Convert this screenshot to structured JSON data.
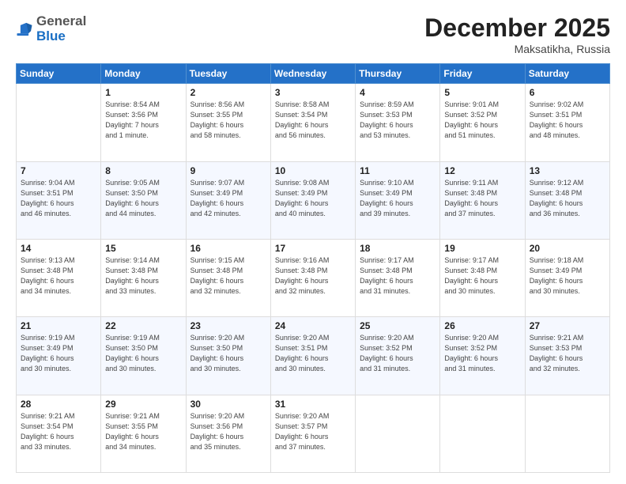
{
  "logo": {
    "general": "General",
    "blue": "Blue"
  },
  "header": {
    "month": "December 2025",
    "location": "Maksatikha, Russia"
  },
  "days_of_week": [
    "Sunday",
    "Monday",
    "Tuesday",
    "Wednesday",
    "Thursday",
    "Friday",
    "Saturday"
  ],
  "weeks": [
    [
      {
        "day": "",
        "info": ""
      },
      {
        "day": "1",
        "info": "Sunrise: 8:54 AM\nSunset: 3:56 PM\nDaylight: 7 hours\nand 1 minute."
      },
      {
        "day": "2",
        "info": "Sunrise: 8:56 AM\nSunset: 3:55 PM\nDaylight: 6 hours\nand 58 minutes."
      },
      {
        "day": "3",
        "info": "Sunrise: 8:58 AM\nSunset: 3:54 PM\nDaylight: 6 hours\nand 56 minutes."
      },
      {
        "day": "4",
        "info": "Sunrise: 8:59 AM\nSunset: 3:53 PM\nDaylight: 6 hours\nand 53 minutes."
      },
      {
        "day": "5",
        "info": "Sunrise: 9:01 AM\nSunset: 3:52 PM\nDaylight: 6 hours\nand 51 minutes."
      },
      {
        "day": "6",
        "info": "Sunrise: 9:02 AM\nSunset: 3:51 PM\nDaylight: 6 hours\nand 48 minutes."
      }
    ],
    [
      {
        "day": "7",
        "info": "Sunrise: 9:04 AM\nSunset: 3:51 PM\nDaylight: 6 hours\nand 46 minutes."
      },
      {
        "day": "8",
        "info": "Sunrise: 9:05 AM\nSunset: 3:50 PM\nDaylight: 6 hours\nand 44 minutes."
      },
      {
        "day": "9",
        "info": "Sunrise: 9:07 AM\nSunset: 3:49 PM\nDaylight: 6 hours\nand 42 minutes."
      },
      {
        "day": "10",
        "info": "Sunrise: 9:08 AM\nSunset: 3:49 PM\nDaylight: 6 hours\nand 40 minutes."
      },
      {
        "day": "11",
        "info": "Sunrise: 9:10 AM\nSunset: 3:49 PM\nDaylight: 6 hours\nand 39 minutes."
      },
      {
        "day": "12",
        "info": "Sunrise: 9:11 AM\nSunset: 3:48 PM\nDaylight: 6 hours\nand 37 minutes."
      },
      {
        "day": "13",
        "info": "Sunrise: 9:12 AM\nSunset: 3:48 PM\nDaylight: 6 hours\nand 36 minutes."
      }
    ],
    [
      {
        "day": "14",
        "info": "Sunrise: 9:13 AM\nSunset: 3:48 PM\nDaylight: 6 hours\nand 34 minutes."
      },
      {
        "day": "15",
        "info": "Sunrise: 9:14 AM\nSunset: 3:48 PM\nDaylight: 6 hours\nand 33 minutes."
      },
      {
        "day": "16",
        "info": "Sunrise: 9:15 AM\nSunset: 3:48 PM\nDaylight: 6 hours\nand 32 minutes."
      },
      {
        "day": "17",
        "info": "Sunrise: 9:16 AM\nSunset: 3:48 PM\nDaylight: 6 hours\nand 32 minutes."
      },
      {
        "day": "18",
        "info": "Sunrise: 9:17 AM\nSunset: 3:48 PM\nDaylight: 6 hours\nand 31 minutes."
      },
      {
        "day": "19",
        "info": "Sunrise: 9:17 AM\nSunset: 3:48 PM\nDaylight: 6 hours\nand 30 minutes."
      },
      {
        "day": "20",
        "info": "Sunrise: 9:18 AM\nSunset: 3:49 PM\nDaylight: 6 hours\nand 30 minutes."
      }
    ],
    [
      {
        "day": "21",
        "info": "Sunrise: 9:19 AM\nSunset: 3:49 PM\nDaylight: 6 hours\nand 30 minutes."
      },
      {
        "day": "22",
        "info": "Sunrise: 9:19 AM\nSunset: 3:50 PM\nDaylight: 6 hours\nand 30 minutes."
      },
      {
        "day": "23",
        "info": "Sunrise: 9:20 AM\nSunset: 3:50 PM\nDaylight: 6 hours\nand 30 minutes."
      },
      {
        "day": "24",
        "info": "Sunrise: 9:20 AM\nSunset: 3:51 PM\nDaylight: 6 hours\nand 30 minutes."
      },
      {
        "day": "25",
        "info": "Sunrise: 9:20 AM\nSunset: 3:52 PM\nDaylight: 6 hours\nand 31 minutes."
      },
      {
        "day": "26",
        "info": "Sunrise: 9:20 AM\nSunset: 3:52 PM\nDaylight: 6 hours\nand 31 minutes."
      },
      {
        "day": "27",
        "info": "Sunrise: 9:21 AM\nSunset: 3:53 PM\nDaylight: 6 hours\nand 32 minutes."
      }
    ],
    [
      {
        "day": "28",
        "info": "Sunrise: 9:21 AM\nSunset: 3:54 PM\nDaylight: 6 hours\nand 33 minutes."
      },
      {
        "day": "29",
        "info": "Sunrise: 9:21 AM\nSunset: 3:55 PM\nDaylight: 6 hours\nand 34 minutes."
      },
      {
        "day": "30",
        "info": "Sunrise: 9:20 AM\nSunset: 3:56 PM\nDaylight: 6 hours\nand 35 minutes."
      },
      {
        "day": "31",
        "info": "Sunrise: 9:20 AM\nSunset: 3:57 PM\nDaylight: 6 hours\nand 37 minutes."
      },
      {
        "day": "",
        "info": ""
      },
      {
        "day": "",
        "info": ""
      },
      {
        "day": "",
        "info": ""
      }
    ]
  ]
}
